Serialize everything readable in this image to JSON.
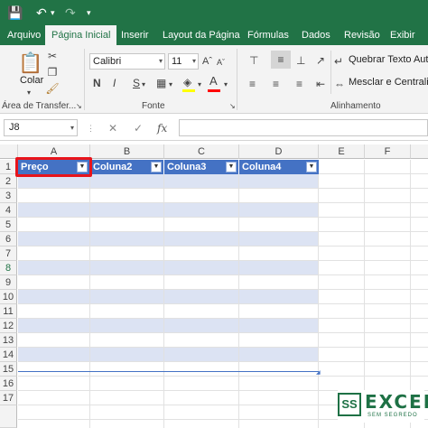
{
  "quick_access": {
    "save_icon": "save-icon",
    "undo_icon": "undo-icon",
    "redo_icon": "redo-icon",
    "customize_icon": "customize-icon"
  },
  "ribbon_tabs": [
    "Arquivo",
    "Página Inicial",
    "Inserir",
    "Layout da Página",
    "Fórmulas",
    "Dados",
    "Revisão",
    "Exibir"
  ],
  "active_tab": "Página Inicial",
  "clipboard": {
    "paste_label": "Colar",
    "group_label": "Área de Transfer..."
  },
  "font": {
    "name": "Calibri",
    "size": "11",
    "bold": "N",
    "italic": "I",
    "underline": "S",
    "group_label": "Fonte",
    "highlight_color": "#ffff00",
    "font_color": "#ff0000"
  },
  "alignment": {
    "wrap_text": "Quebrar Texto Autom",
    "merge_center": "Mesclar e Centralizar",
    "group_label": "Alinhamento"
  },
  "formula_bar": {
    "name_box": "J8",
    "cancel": "✕",
    "enter": "✓",
    "fx": "fx",
    "value": ""
  },
  "columns": [
    "A",
    "B",
    "C",
    "D",
    "E",
    "F"
  ],
  "rows": [
    "1",
    "2",
    "3",
    "4",
    "5",
    "6",
    "7",
    "8",
    "9",
    "10",
    "11",
    "12",
    "13",
    "14",
    "15",
    "16",
    "17"
  ],
  "selected_row": "8",
  "table": {
    "headers": [
      "Preço",
      "Coluna2",
      "Coluna3",
      "Coluna4"
    ],
    "header_color": "#4472c4",
    "band_color": "#dce3f3",
    "highlight_color": "#e8141b"
  },
  "logo": {
    "mark": "SS",
    "word": "EXCEL",
    "tagline": "SEM SEGREDO"
  }
}
